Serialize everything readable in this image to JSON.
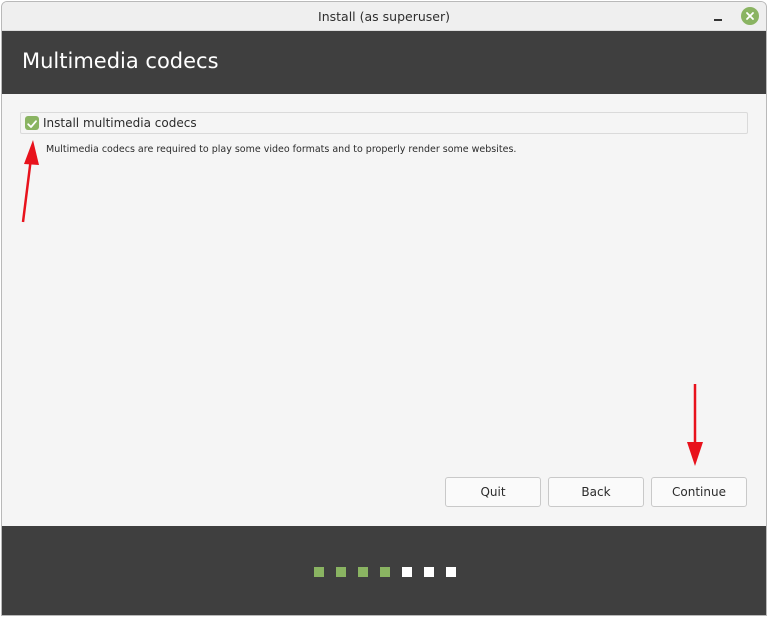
{
  "window": {
    "title": "Install (as superuser)"
  },
  "header": {
    "title": "Multimedia codecs"
  },
  "option": {
    "label": "Install multimedia codecs",
    "checked": true,
    "description": "Multimedia codecs are required to play some video formats and to properly render some websites."
  },
  "buttons": {
    "quit": "Quit",
    "back": "Back",
    "continue": "Continue"
  },
  "progress": {
    "total_steps": 7,
    "completed_steps": 4
  },
  "colors": {
    "accent": "#8ab462",
    "header_bg": "#3f3f3f",
    "annotation_arrow": "#e8121c",
    "pending_dot": "#ffffff"
  },
  "icons": {
    "minimize": "minimize-icon",
    "close": "close-icon",
    "check": "checkmark-icon"
  }
}
